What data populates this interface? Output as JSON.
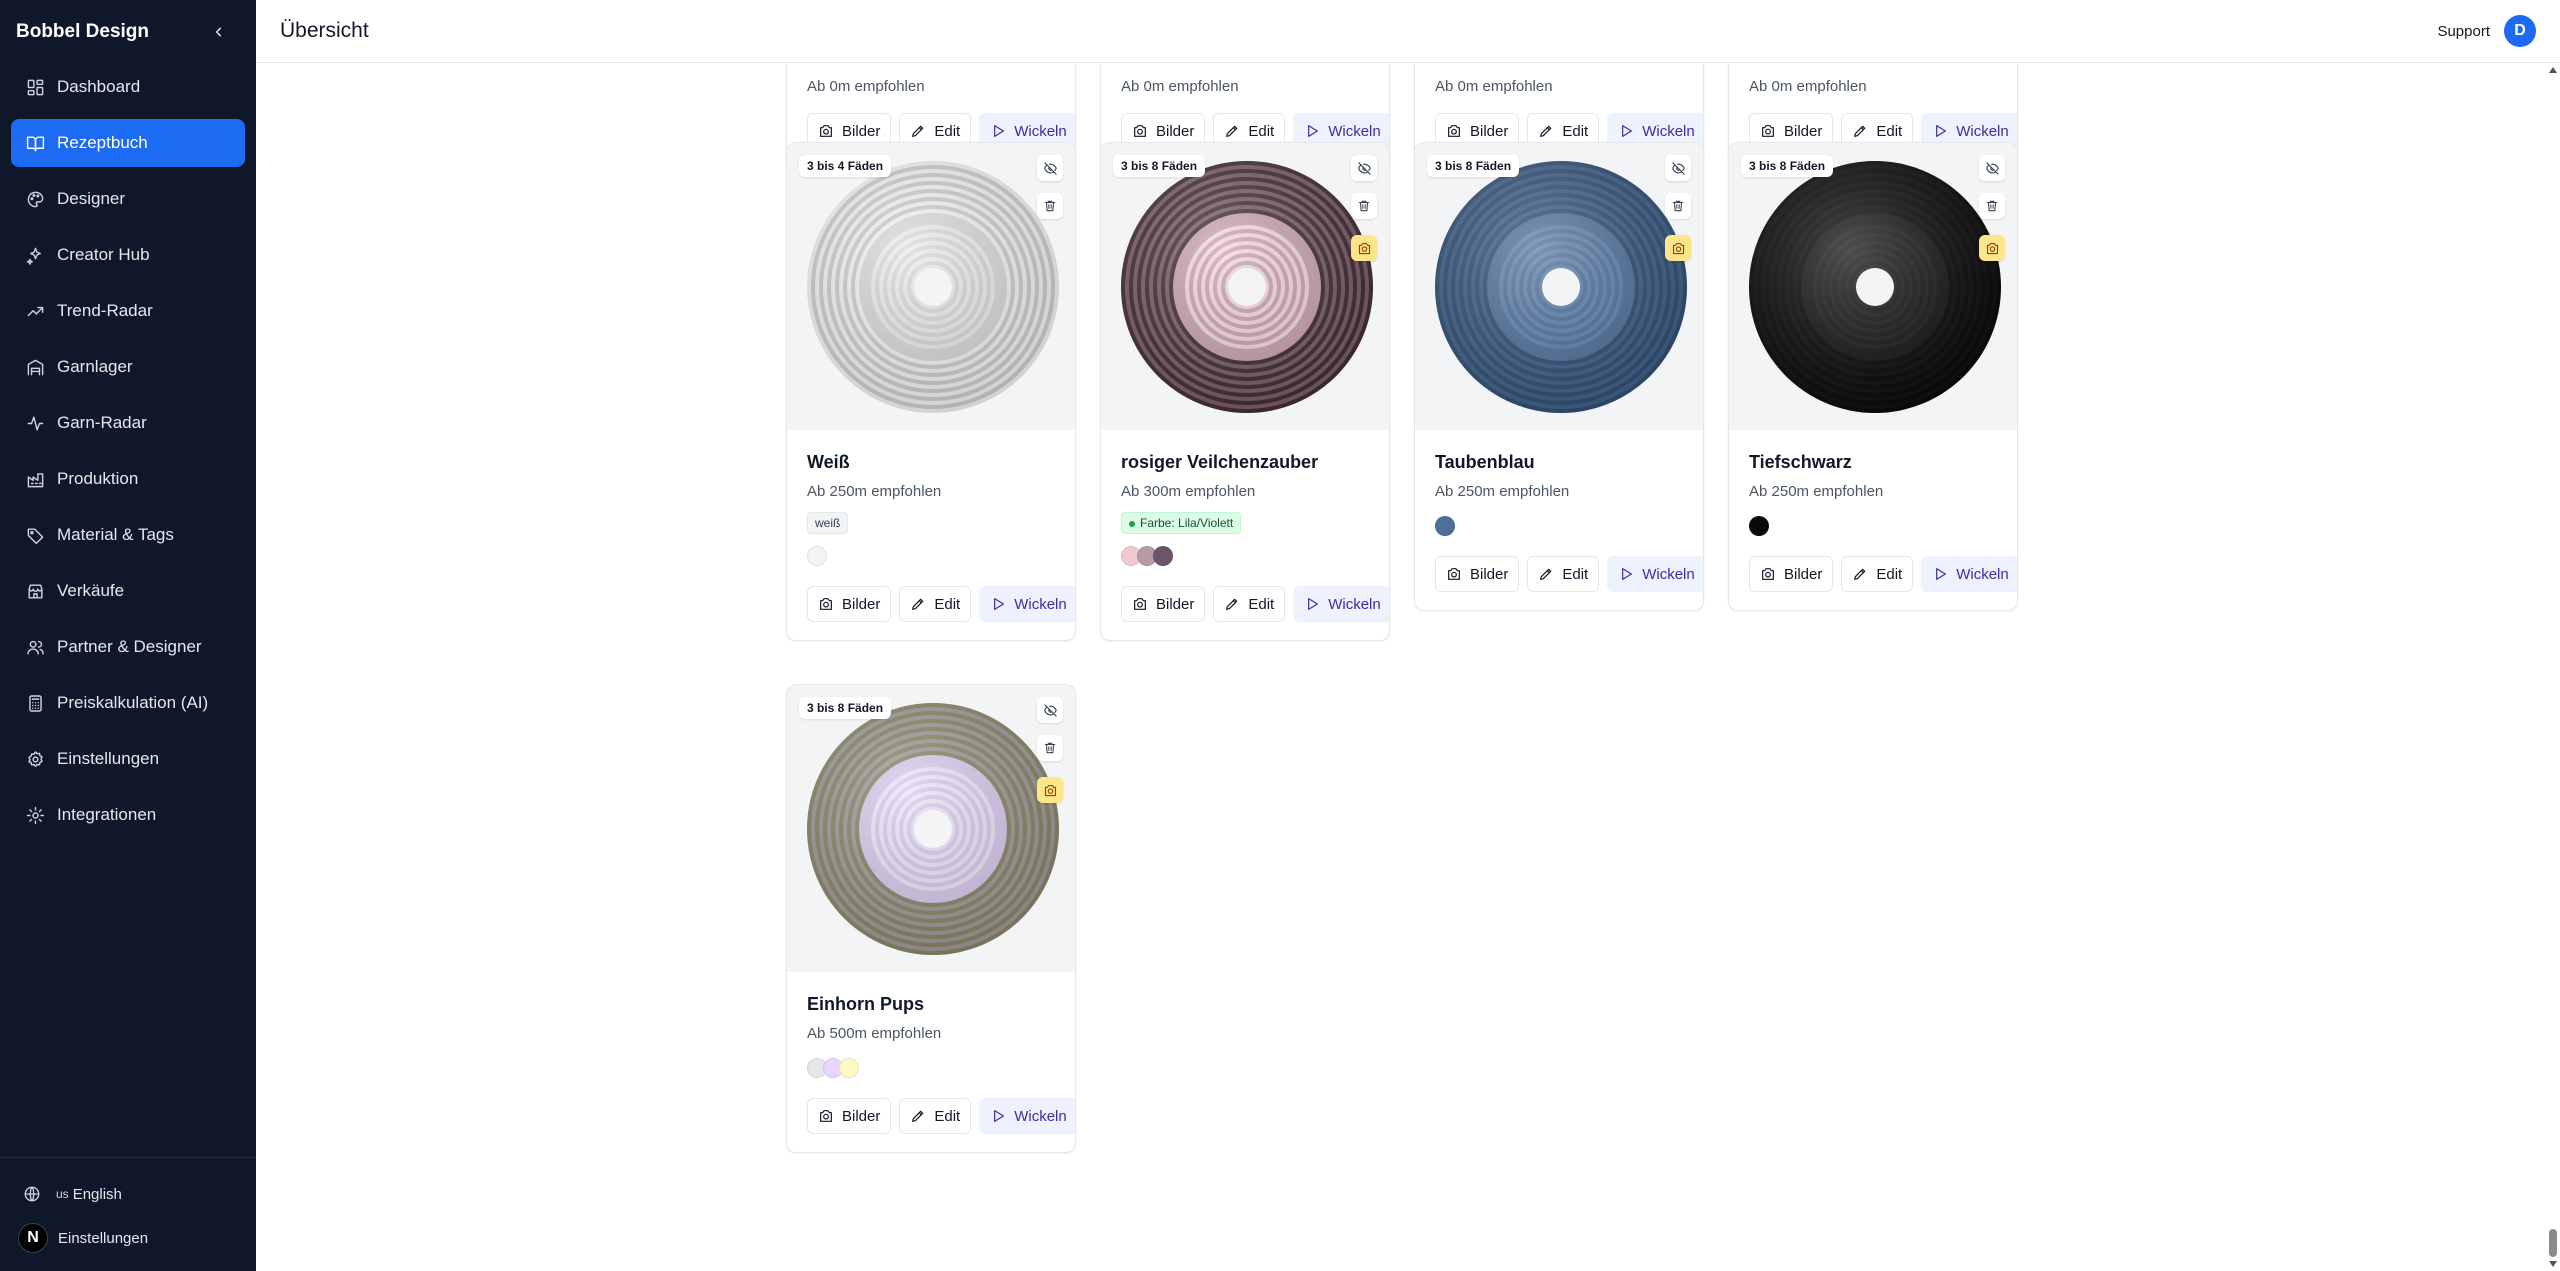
{
  "app": {
    "brand": "Bobbel Design"
  },
  "sidebar": {
    "items": [
      {
        "label": "Dashboard",
        "icon": "dashboard-icon",
        "active": false
      },
      {
        "label": "Rezeptbuch",
        "icon": "book-icon",
        "active": true
      },
      {
        "label": "Designer",
        "icon": "palette-icon",
        "active": false
      },
      {
        "label": "Creator Hub",
        "icon": "sparkles-icon",
        "active": false
      },
      {
        "label": "Trend-Radar",
        "icon": "trending-up-icon",
        "active": false
      },
      {
        "label": "Garnlager",
        "icon": "warehouse-icon",
        "active": false
      },
      {
        "label": "Garn-Radar",
        "icon": "activity-icon",
        "active": false
      },
      {
        "label": "Produktion",
        "icon": "factory-icon",
        "active": false
      },
      {
        "label": "Material & Tags",
        "icon": "tag-icon",
        "active": false
      },
      {
        "label": "Verkäufe",
        "icon": "store-icon",
        "active": false
      },
      {
        "label": "Partner & Designer",
        "icon": "users-icon",
        "active": false
      },
      {
        "label": "Preiskalkulation (AI)",
        "icon": "calculator-icon",
        "active": false
      },
      {
        "label": "Einstellungen",
        "icon": "settings-icon",
        "active": false
      },
      {
        "label": "Integrationen",
        "icon": "cog-icon",
        "active": false
      }
    ],
    "footer": {
      "language_flag": "us",
      "language_label": "English",
      "settings_label": "Einstellungen",
      "avatar_letter": "N"
    }
  },
  "header": {
    "title": "Übersicht",
    "support_label": "Support",
    "avatar_letter": "D"
  },
  "actions": {
    "images": "Bilder",
    "edit": "Edit",
    "wind": "Wickeln"
  },
  "top_row": [
    {
      "subtitle": "Ab 0m empfohlen"
    },
    {
      "subtitle": "Ab 0m empfohlen"
    },
    {
      "subtitle": "Ab 0m empfohlen"
    },
    {
      "subtitle": "Ab 0m empfohlen"
    }
  ],
  "recipes": [
    {
      "name": "Weiß",
      "subtitle": "Ab 250m empfohlen",
      "threads": "3 bis 4 Fäden",
      "tag": "weiß",
      "tag_style": "gray",
      "swatches": [
        "#f3f4f6"
      ],
      "camera_highlight": false,
      "disc": [
        "#f5f5f5",
        "#d9d9d9",
        "#ececec",
        "#cfcfcf"
      ]
    },
    {
      "name": "rosiger Veilchenzauber",
      "subtitle": "Ab 300m empfohlen",
      "threads": "3 bis 8 Fäden",
      "tag": "Farbe: Lila/Violett",
      "tag_style": "green",
      "swatches": [
        "#f0c9d0",
        "#b89aa6",
        "#6e5468"
      ],
      "camera_highlight": true,
      "disc": [
        "#3e2a33",
        "#c9a1ae",
        "#f2d7dd",
        "#7a5a66"
      ]
    },
    {
      "name": "Taubenblau",
      "subtitle": "Ab 250m empfohlen",
      "threads": "3 bis 8 Fäden",
      "tag": "",
      "tag_style": "",
      "swatches": [
        "#4f6f99"
      ],
      "camera_highlight": true,
      "disc": [
        "#2f4d73",
        "#4d6f99",
        "#5d80ab",
        "#3d5f88"
      ]
    },
    {
      "name": "Tiefschwarz",
      "subtitle": "Ab 250m empfohlen",
      "threads": "3 bis 8 Fäden",
      "tag": "",
      "tag_style": "",
      "swatches": [
        "#0a0a0a"
      ],
      "camera_highlight": true,
      "disc": [
        "#050505",
        "#111111",
        "#181818",
        "#0b0b0b"
      ]
    },
    {
      "name": "Einhorn Pups",
      "subtitle": "Ab 500m empfohlen",
      "threads": "3 bis 8 Fäden",
      "tag": "",
      "tag_style": "",
      "swatches": [
        "#e5e7eb",
        "#e9d5ff",
        "#fef9c3"
      ],
      "camera_highlight": true,
      "disc": [
        "#8a8466",
        "#d8c9ee",
        "#ece4f7",
        "#9e9a9a"
      ]
    }
  ],
  "colors": {
    "sidebar_bg": "#0f172a",
    "accent": "#1d6bf3",
    "wind_bg": "#eef2ff",
    "camera_bg": "#fde68a"
  }
}
